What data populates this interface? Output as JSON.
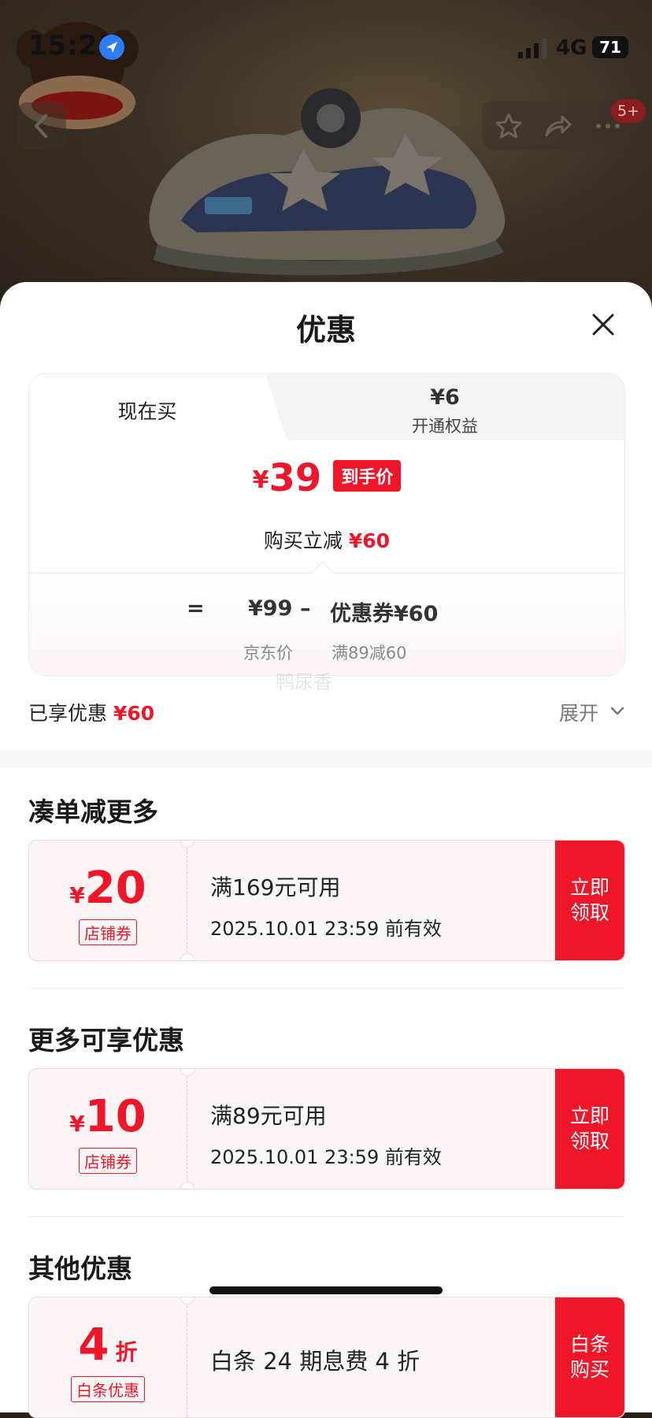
{
  "status_bar": {
    "time": "15:25",
    "network": "4G",
    "battery": "71"
  },
  "top_actions": {
    "badge": "5+"
  },
  "sheet": {
    "title": "优惠",
    "tabs": {
      "now": "现在买",
      "member_price": "¥6",
      "member_label": "开通权益"
    },
    "final": {
      "yen": "¥",
      "price": "39",
      "tag": "到手价"
    },
    "reduce": {
      "text": "购买立减",
      "amount": "¥60"
    },
    "breakdown": {
      "eq": "=",
      "jd_price": "¥99",
      "minus": "–",
      "coupon": "优惠券¥60",
      "jd_label": "京东价",
      "coupon_rule": "满89减60"
    },
    "watermark": "鸭尿香",
    "enjoyed": {
      "label": "已享优惠",
      "amount": "¥60"
    },
    "expand": "展开"
  },
  "sections": [
    {
      "title": "凑单减更多",
      "coupon": {
        "yen": "¥",
        "amount": "20",
        "type": "店铺券",
        "condition": "满169元可用",
        "valid": "2025.10.01 23:59 前有效",
        "action": "立即领取"
      }
    },
    {
      "title": "更多可享优惠",
      "coupon": {
        "yen": "¥",
        "amount": "10",
        "type": "店铺券",
        "condition": "满89元可用",
        "valid": "2025.10.01 23:59 前有效",
        "action": "立即领取"
      }
    },
    {
      "title": "其他优惠",
      "coupon": {
        "amount": "4",
        "unit": "折",
        "type": "白条优惠",
        "condition": "白条 24 期息费 4 折",
        "action": "白条购买"
      }
    }
  ],
  "colors": {
    "accent": "#f0162a",
    "coupon_bg": "#fcf5f6",
    "tab_bg": "#f3f4f8"
  },
  "icons": [
    "location-arrow-icon",
    "signal-icon",
    "back-chevron-icon",
    "star-icon",
    "share-icon",
    "more-icon",
    "close-icon",
    "chevron-down-icon"
  ]
}
